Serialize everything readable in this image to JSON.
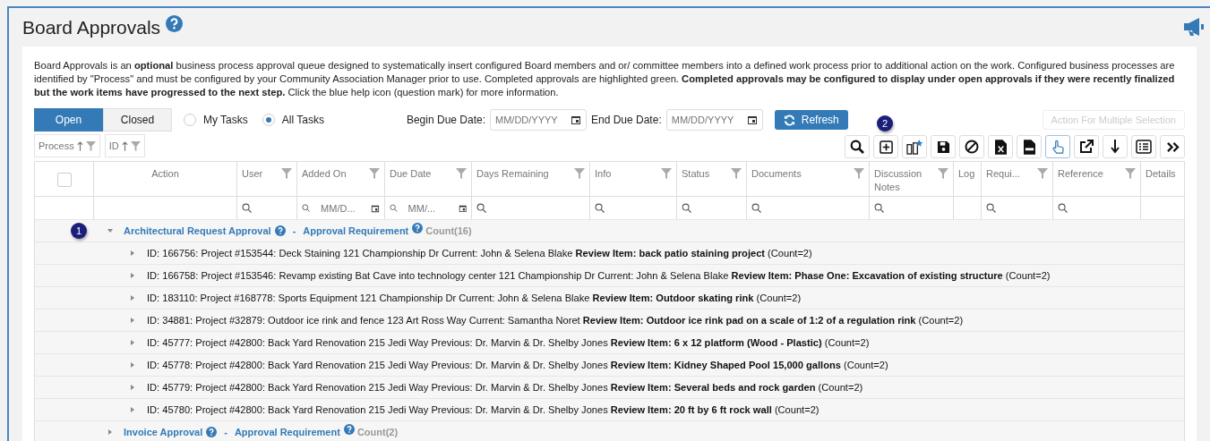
{
  "title": "Board Approvals",
  "description": "Board Approvals is an **optional** business process approval queue designed to systematically insert configured Board members and or/ committee members into a defined work process prior to additional action on the work. Configured business processes are identified by \"Process\" and must be configured by your Community Association Manager prior to use. Completed approvals are highlighted green. **Completed approvals may be configured to display under open approvals if they were recently finalized but the work items have progressed to the next step.** Click the blue help icon (question mark) for more information.",
  "tabs": [
    {
      "label": "Open",
      "selected": true
    },
    {
      "label": "Closed",
      "selected": false
    }
  ],
  "task_filter": [
    {
      "label": "My Tasks",
      "selected": false
    },
    {
      "label": "All Tasks",
      "selected": true
    }
  ],
  "date_filters": [
    {
      "label": "Begin Due Date:",
      "placeholder": "MM/DD/YYYY"
    },
    {
      "label": "End Due Date:",
      "placeholder": "MM/DD/YYYY"
    }
  ],
  "refresh_button": "Refresh",
  "multi_action_button": {
    "label": "Action For Multiple Selection",
    "disabled": true
  },
  "sort_chips": [
    {
      "label": "Process"
    },
    {
      "label": "ID"
    }
  ],
  "toolbar_badge": "2",
  "toolbar": [
    {
      "kind": "search"
    },
    {
      "kind": "plus"
    },
    {
      "kind": "columns"
    },
    {
      "kind": "save"
    },
    {
      "kind": "block"
    },
    {
      "kind": "excel"
    },
    {
      "kind": "csv"
    },
    {
      "kind": "hand",
      "selected": true
    },
    {
      "kind": "export"
    },
    {
      "kind": "down"
    },
    {
      "kind": "list"
    },
    {
      "kind": "more"
    }
  ],
  "columns": [
    {
      "kind": "check",
      "checked": false,
      "filter": false
    },
    {
      "label": "Action",
      "kind": "action",
      "filter": false
    },
    {
      "label": "User",
      "kind": "text",
      "filter": true
    },
    {
      "label": "Added On",
      "kind": "date",
      "filter": true,
      "placeholder": "MM/D..."
    },
    {
      "label": "Due Date",
      "kind": "date",
      "filter": true,
      "placeholder": "MM/..."
    },
    {
      "label": "Days Remaining",
      "kind": "text",
      "filter": true
    },
    {
      "label": "Info",
      "kind": "text",
      "filter": true
    },
    {
      "label": "Status",
      "kind": "text",
      "filter": true
    },
    {
      "label": "Documents",
      "kind": "text",
      "filter": true
    },
    {
      "label": "Discussion Notes",
      "kind": "text",
      "filter": true
    },
    {
      "label": "Log",
      "kind": "plain",
      "filter": false
    },
    {
      "label": "Requi...",
      "kind": "text",
      "filter": true
    },
    {
      "label": "Reference",
      "kind": "text",
      "filter": true
    },
    {
      "label": "Details",
      "kind": "plain",
      "filter": false
    }
  ],
  "groups": [
    {
      "badge": "1",
      "expanded": true,
      "title": "Architectural Request Approval",
      "separator": "-",
      "requirement": "Approval Requirement",
      "count": "Count(16)",
      "rows": [
        "ID: 166756: Project #153544: Deck Staining 121 Championship Dr Current: John & Selena Blake **Review Item: back patio staining project** (Count=2)",
        "ID: 166758: Project #153546: Revamp existing Bat Cave into technology center 121 Championship Dr Current: John & Selena Blake **Review Item: Phase One: Excavation of existing structure** (Count=2)",
        "ID: 183110: Project #168778: Sports Equipment 121 Championship Dr Current: John & Selena Blake **Review Item: Outdoor skating rink** (Count=2)",
        "ID: 34881: Project #32879: Outdoor ice rink and fence 123 Art Ross Way Current: Samantha Noret **Review Item: Outdoor ice rink pad on a scale of 1:2 of a regulation rink** (Count=2)",
        "ID: 45777: Project #42800: Back Yard Renovation 215 Jedi Way Previous: Dr. Marvin & Dr. Shelby Jones **Review Item: 6 x 12 platform (Wood - Plastic)** (Count=2)",
        "ID: 45778: Project #42800: Back Yard Renovation 215 Jedi Way Previous: Dr. Marvin & Dr. Shelby Jones **Review Item: Kidney Shaped Pool 15,000 gallons** (Count=2)",
        "ID: 45779: Project #42800: Back Yard Renovation 215 Jedi Way Previous: Dr. Marvin & Dr. Shelby Jones **Review Item: Several beds and rock garden** (Count=2)",
        "ID: 45780: Project #42800: Back Yard Renovation 215 Jedi Way Previous: Dr. Marvin & Dr. Shelby Jones **Review Item: 20 ft by 6 ft rock wall** (Count=2)"
      ]
    },
    {
      "expanded": false,
      "title": "Invoice Approval",
      "separator": "-",
      "requirement": "Approval Requirement",
      "count": "Count(2)"
    }
  ]
}
